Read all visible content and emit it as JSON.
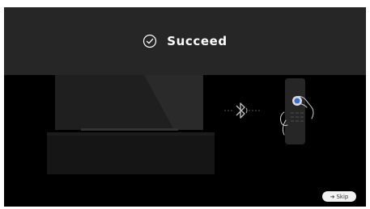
{
  "status": {
    "icon": "check-circle-icon",
    "text": "Succeed"
  },
  "illustration": {
    "tv_icon": "tv-icon",
    "bluetooth_icon": "bluetooth-icon",
    "remote_icon": "remote-control-icon",
    "hand_icon": "hand-icon"
  },
  "skip": {
    "icon": "arrow-right-icon",
    "label": "Skip"
  },
  "colors": {
    "background": "#000000",
    "banner": "#262626",
    "text": "#ffffff",
    "skip_bg": "#f2f2f2"
  }
}
